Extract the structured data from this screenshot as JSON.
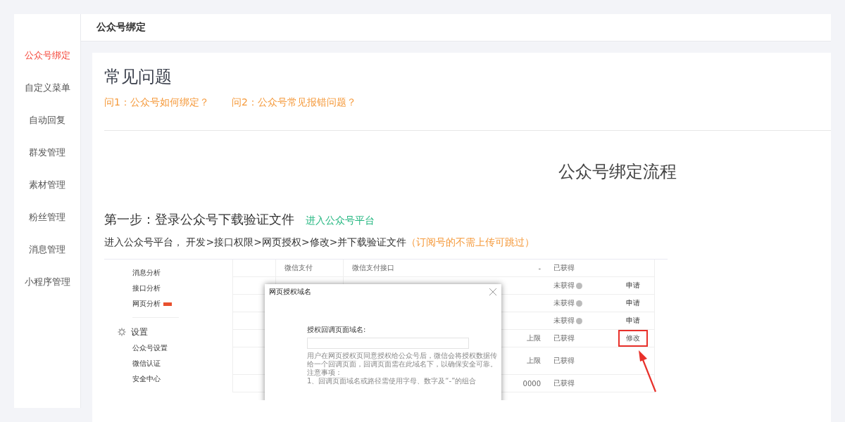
{
  "header": {
    "title": "公众号绑定"
  },
  "sidebar": {
    "items": [
      {
        "label": "公众号绑定",
        "selected": true
      },
      {
        "label": "自定义菜单",
        "selected": false
      },
      {
        "label": "自动回复",
        "selected": false
      },
      {
        "label": "群发管理",
        "selected": false
      },
      {
        "label": "素材管理",
        "selected": false
      },
      {
        "label": "粉丝管理",
        "selected": false
      },
      {
        "label": "消息管理",
        "selected": false
      },
      {
        "label": "小程序管理",
        "selected": false
      }
    ]
  },
  "faq": {
    "title": "常见问题",
    "links": [
      "问1：公众号如何绑定？",
      "问2：公众号常见报错问题？"
    ]
  },
  "process_title": "公众号绑定流程",
  "step": {
    "title": "第一步：登录公众号下载验证文件",
    "link": "进入公众号平台",
    "instruction": "进入公众号平台， 开发>接口权限>网页授权>修改>并下载验证文件",
    "note": "（订阅号的不需上传可跳过）"
  },
  "embedded_screenshot": {
    "nav": [
      {
        "label": "消息分析",
        "badge": false
      },
      {
        "label": "接口分析",
        "badge": false
      },
      {
        "label": "网页分析",
        "badge": true
      }
    ],
    "settings": {
      "title": "设置",
      "items": [
        "公众号设置",
        "微信认证",
        "安全中心"
      ]
    },
    "table_rows": [
      {
        "column_2": "微信支付",
        "column_3": "微信支付接口",
        "column_4": "-",
        "status": "已获得",
        "help": false,
        "action": "",
        "highlighted": false
      },
      {
        "column_2": "",
        "column_3": "",
        "column_4": "",
        "status": "未获得",
        "help": true,
        "action": "申请",
        "highlighted": false
      },
      {
        "column_2": "",
        "column_3": "",
        "column_4": "",
        "status": "未获得",
        "help": true,
        "action": "申请",
        "highlighted": false
      },
      {
        "column_2": "",
        "column_3": "",
        "column_4": "",
        "status": "未获得",
        "help": true,
        "action": "申请",
        "highlighted": false
      },
      {
        "column_2": "",
        "column_3": "",
        "column_4": "上限",
        "status": "已获得",
        "help": false,
        "action": "修改",
        "highlighted": true
      },
      {
        "column_2": "",
        "column_3": "",
        "column_4": "上限",
        "status": "已获得",
        "help": false,
        "action": "",
        "highlighted": false
      },
      {
        "column_2": "",
        "column_3": "",
        "column_4": "0000",
        "status": "已获得",
        "help": false,
        "action": "",
        "highlighted": false
      }
    ],
    "dialog": {
      "title": "网页授权域名",
      "field_label": "授权回调页面域名:",
      "help": "用户在网页授权页同意授权给公众号后，微信会将授权数据传给一个回调页面，回调页面需在此域名下，以确保安全可靠。",
      "notes_title": "注意事项：",
      "notes": [
        "1、回调页面域名或路径需使用字母、数字及“-”的组合"
      ]
    }
  }
}
